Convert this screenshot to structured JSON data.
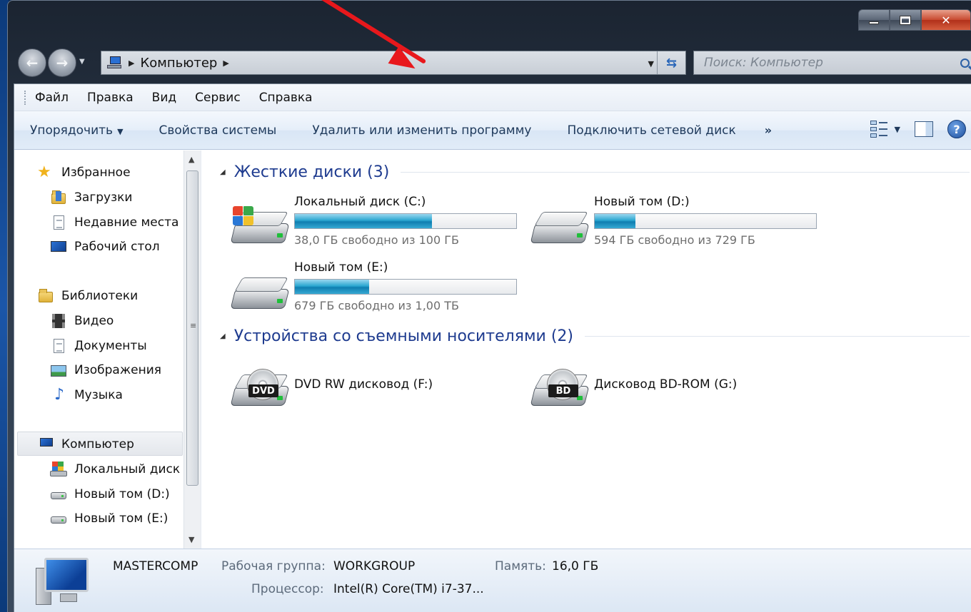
{
  "address_bar": {
    "path_item": "Компьютер"
  },
  "search": {
    "placeholder": "Поиск: Компьютер"
  },
  "menubar": {
    "items": [
      "Файл",
      "Правка",
      "Вид",
      "Сервис",
      "Справка"
    ]
  },
  "toolbar": {
    "organize": "Упорядочить",
    "system_properties": "Свойства системы",
    "uninstall": "Удалить или изменить программу",
    "map_drive": "Подключить сетевой диск",
    "more": "»"
  },
  "navpane": {
    "favorites": "Избранное",
    "downloads": "Загрузки",
    "recent": "Недавние места",
    "desktop": "Рабочий стол",
    "libraries": "Библиотеки",
    "video": "Видео",
    "documents": "Документы",
    "images": "Изображения",
    "music": "Музыка",
    "computer": "Компьютер",
    "local_disk": "Локальный диск",
    "vol_d": "Новый том (D:)",
    "vol_e": "Новый том (E:)"
  },
  "groups": {
    "hard_disks": "Жесткие диски (3)",
    "removable": "Устройства со съемными носителями (2)"
  },
  "drives": [
    {
      "name": "Локальный диск (C:)",
      "free": "38,0 ГБ свободно из 100 ГБ",
      "used_fraction": 0.62
    },
    {
      "name": "Новый том (D:)",
      "free": "594 ГБ свободно из 729 ГБ",
      "used_fraction": 0.185
    },
    {
      "name": "Новый том (E:)",
      "free": "679 ГБ свободно из 1,00 ТБ",
      "used_fraction": 0.337
    }
  ],
  "removable": [
    {
      "name": "DVD RW дисковод (F:)",
      "badge": "DVD"
    },
    {
      "name": "Дисковод BD-ROM (G:)",
      "badge": "BD"
    }
  ],
  "details": {
    "computer_name": "MASTERCOMP",
    "workgroup_label": "Рабочая группа:",
    "workgroup_value": "WORKGROUP",
    "memory_label": "Память:",
    "memory_value": "16,0 ГБ",
    "cpu_label": "Процессор:",
    "cpu_value": "Intel(R) Core(TM) i7-37..."
  },
  "colors": {
    "group_title": "#1e3b8f",
    "usage_bar": "#1c93c4",
    "annotation_arrow": "#e8181c"
  }
}
